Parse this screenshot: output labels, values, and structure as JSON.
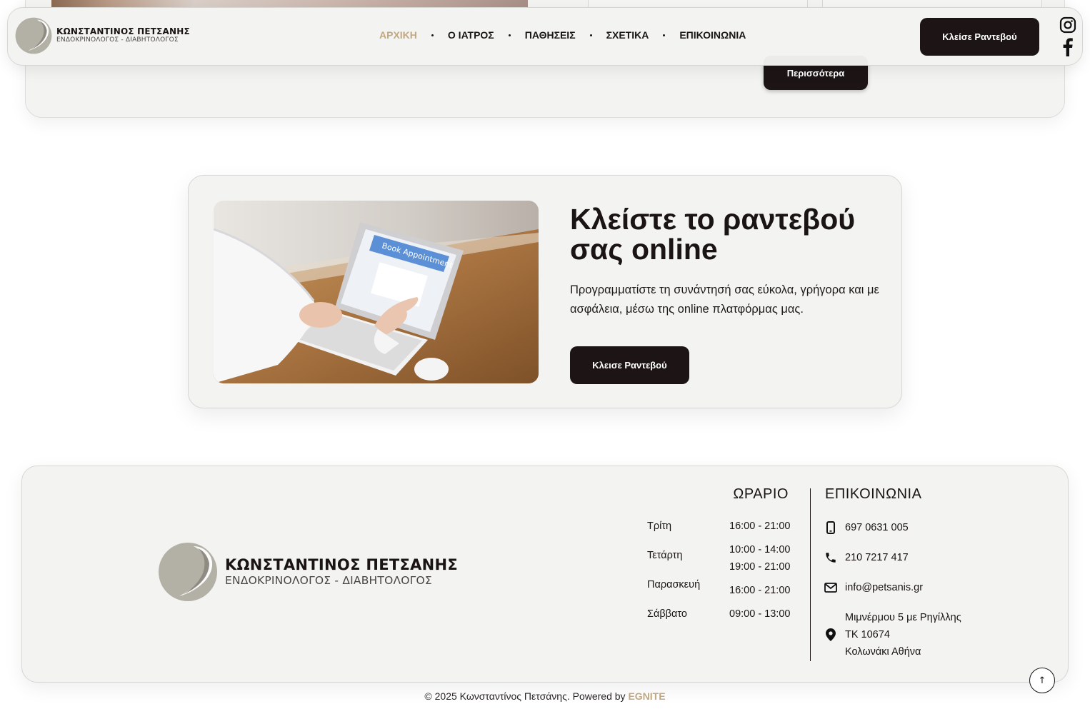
{
  "header": {
    "logo": {
      "name": "ΚΩΝΣΤΑΝΤΙΝΟΣ ΠΕΤΣΑΝΗΣ",
      "subtitle": "ΕΝΔΟΚΡΙΝΟΛΟΓΟΣ - ΔΙΑΒΗΤΟΛΟΓΟΣ"
    },
    "nav": [
      {
        "label": "ΑΡΧΙΚΗ",
        "active": true
      },
      {
        "label": "Ο ΙΑΤΡΟΣ",
        "active": false
      },
      {
        "label": "ΠΑΘΗΣΕΙΣ",
        "active": false
      },
      {
        "label": "ΣΧΕΤΙΚΑ",
        "active": false
      },
      {
        "label": "ΕΠΙΚΟΙΝΩΝΙΑ",
        "active": false
      }
    ],
    "cta_label": "Κλείσε Ραντεβού",
    "social": [
      "instagram-icon",
      "facebook-icon"
    ]
  },
  "previous_section": {
    "more_label": "Περισσότερα"
  },
  "booking": {
    "title": "Κλείστε το ραντεβού σας online",
    "description": "Προγραμματίστε τη συνάντησή σας εύκολα, γρήγορα και με ασφάλεια, μέσω της online πλατφόρμας μας.",
    "button_label": "Κλεισε Ραντεβού",
    "image_text": "Book Appointment"
  },
  "footer": {
    "logo": {
      "name": "ΚΩΝΣΤΑΝΤΙΝΟΣ ΠΕΤΣΑΝΗΣ",
      "subtitle": "ΕΝΔΟΚΡΙΝΟΛΟΓΟΣ - ΔΙΑΒΗΤΟΛΟΓΟΣ"
    },
    "hours_title": "ΩΡΑΡΙΟ",
    "hours": [
      {
        "day": "Τρίτη",
        "time": "16:00 - 21:00"
      },
      {
        "day": "Τετάρτη",
        "time": "10:00 - 14:00",
        "time2": "19:00 - 21:00"
      },
      {
        "day": "Παρασκευή",
        "time": "16:00 - 21:00"
      },
      {
        "day": "Σάββατο",
        "time": "09:00 - 13:00"
      }
    ],
    "contact_title": "ΕΠΙΚΟΙΝΩΝΙΑ",
    "contact": {
      "mobile": "697 0631 005",
      "phone": "210 7217 417",
      "email": "info@petsanis.gr",
      "address_line1": "Μιμνέρμου 5 με Ρηγίλλης",
      "address_line2": "ΤΚ 10674",
      "address_line3": "Κολωνάκι Αθήνα"
    },
    "to_top_icon": "↑"
  },
  "copyright": {
    "text": "© 2025 Κωνσταντίνος Πετσάνης. Powered by ",
    "brand": "EGNITE"
  },
  "colors": {
    "accent": "#c2a77f",
    "dark": "#1c1415",
    "card_bg": "#f3f3f1",
    "logo_grey": "#b3b0a6"
  }
}
